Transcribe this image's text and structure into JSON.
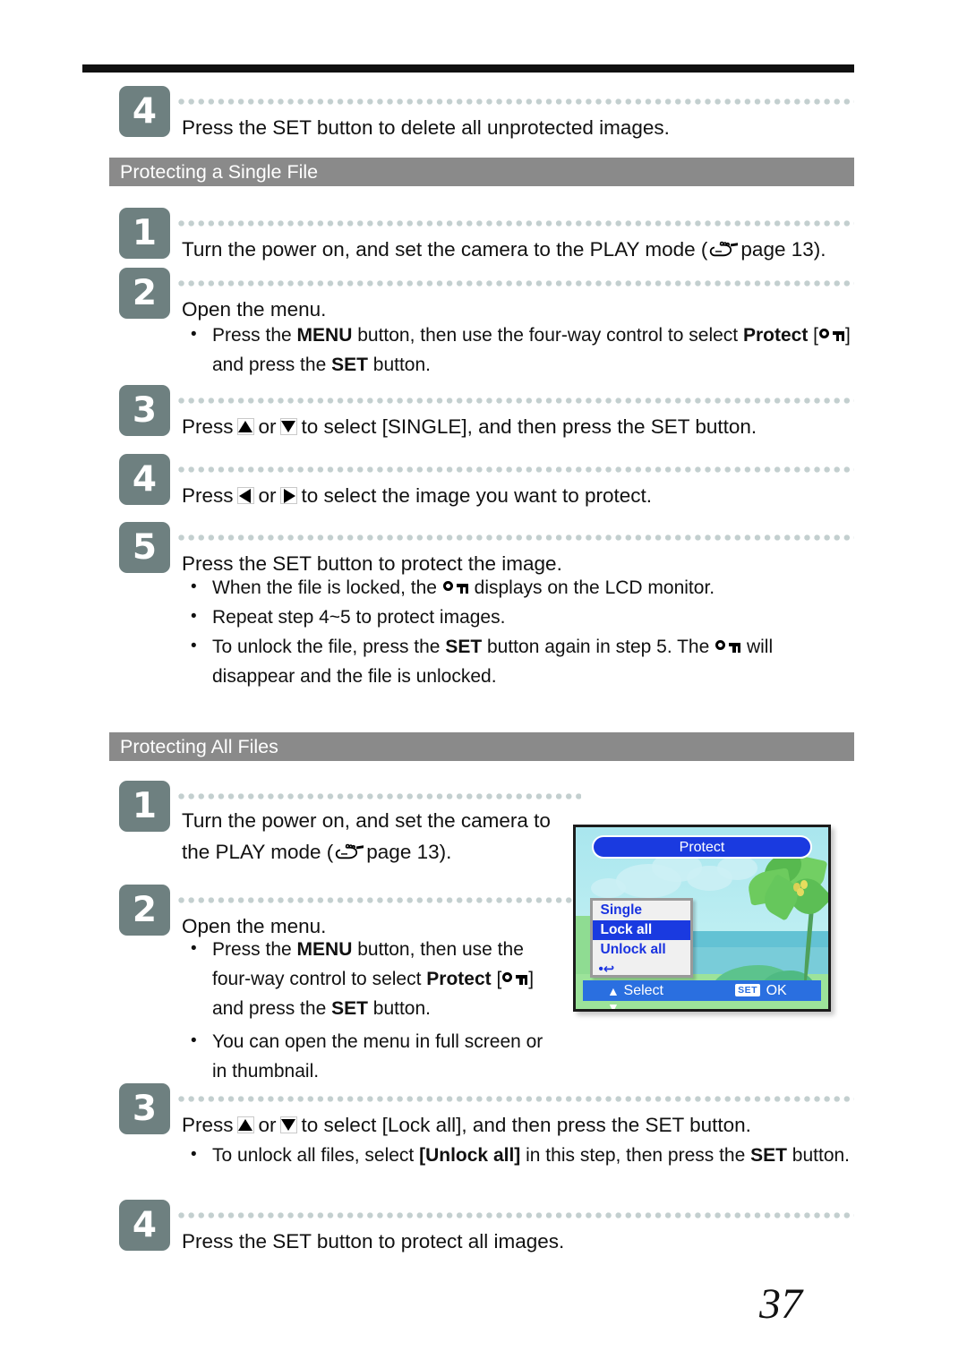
{
  "page": {
    "number": "37",
    "icons": {
      "protect_key": "key-icon",
      "hand_pointer": "pointing-hand-icon",
      "arrow_up": "arrow-up-icon",
      "arrow_down": "arrow-down-icon",
      "arrow_left": "arrow-left-icon",
      "arrow_right": "arrow-right-icon"
    },
    "colors": {
      "badge": "#6e8080",
      "section_bar": "#8a8a8a",
      "dots": "#c3cfcf",
      "rule": "#111111",
      "lcd_blue": "#1a3ae0",
      "lcd_bottom_bar": "#2a6fe0"
    }
  },
  "intro_step": {
    "number": "4",
    "text": "Press the SET button to delete all unprotected images."
  },
  "section_single": {
    "heading": "Protecting a Single File",
    "steps": [
      {
        "number": "1",
        "text_before": "Turn the power on, and set the camera to the PLAY mode (",
        "text_after": "page 13)."
      },
      {
        "number": "2",
        "text": "Open the menu.",
        "bullets": [
          {
            "part1": "Press the ",
            "bold1": "MENU",
            "part2": " button, then use the four-way control to select ",
            "bold2": "Protect",
            "part3": " [",
            "icon": "key-icon",
            "part4": "] and press the ",
            "bold3": "SET",
            "part5": " button."
          }
        ]
      },
      {
        "number": "3",
        "text_a": "Press",
        "icon_a": "arrow-up-icon",
        "text_b": "or",
        "icon_b": "arrow-down-icon",
        "text_c": "to select [SINGLE], and then press the SET button."
      },
      {
        "number": "4",
        "text_a": "Press",
        "icon_a": "arrow-left-icon",
        "text_b": "or",
        "icon_b": "arrow-right-icon",
        "text_c": "to select the image you want to protect."
      },
      {
        "number": "5",
        "text": "Press the SET button to protect the image.",
        "bullets": [
          {
            "part1": "When the file is locked, the ",
            "icon": "key-icon",
            "part2": " displays on the LCD monitor."
          },
          {
            "part1": "Repeat step 4~5 to protect images."
          },
          {
            "part1": "To unlock the file, press the ",
            "bold1": "SET",
            "part2": " button again in step 5. The ",
            "icon": "key-icon",
            "part3": " will disappear and the file is unlocked."
          }
        ]
      }
    ]
  },
  "section_all": {
    "heading": "Protecting All Files",
    "steps": [
      {
        "number": "1",
        "line1": "Turn the power on, and set the camera to",
        "line2_before": "the PLAY mode (",
        "line2_after": "page 13)."
      },
      {
        "number": "2",
        "text": "Open the menu.",
        "bullets": [
          {
            "part1": "Press the ",
            "bold1": "MENU",
            "part2": " button, then use the four-way control to select ",
            "bold2": "Protect",
            "part3": " [",
            "icon": "key-icon",
            "part4": "] and press the ",
            "bold3": "SET",
            "part5": " button."
          },
          {
            "part1": "You can open the menu in full screen or in thumbnail."
          }
        ]
      },
      {
        "number": "3",
        "text_a": "Press",
        "icon_a": "arrow-up-icon",
        "text_b": "or",
        "icon_b": "arrow-down-icon",
        "text_c": "to select [Lock all], and then press the SET button.",
        "bullets": [
          {
            "part1": "To unlock all files, select ",
            "bold1": "[Unlock all]",
            "part2": " in this step, then press the ",
            "bold2": "SET",
            "part3": " button."
          }
        ]
      },
      {
        "number": "4",
        "text": "Press the SET button to protect all images."
      }
    ]
  },
  "lcd_screen": {
    "title": "Protect",
    "menu_items": [
      "Single",
      "Lock all",
      "Unlock all"
    ],
    "menu_return_icon": "return-arrow-icon",
    "selected_item": "Lock all",
    "footer_select_label": "Select",
    "footer_set_badge": "SET",
    "footer_ok_label": "OK",
    "footer_updown_icon": "up-down-arrow-icon"
  }
}
